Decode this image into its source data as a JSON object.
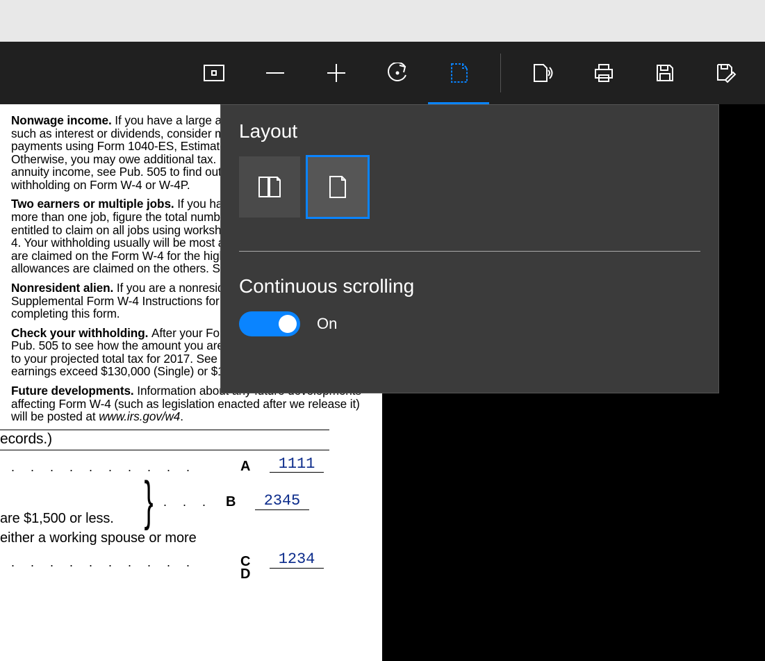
{
  "toolbar": {
    "icons": [
      "fit-page-icon",
      "zoom-out-icon",
      "zoom-in-icon",
      "rotate-icon",
      "layout-icon",
      "read-aloud-icon",
      "print-icon",
      "save-icon",
      "save-as-icon"
    ]
  },
  "flyout": {
    "layout_title": "Layout",
    "scroll_title": "Continuous scrolling",
    "toggle_state": "On"
  },
  "doc": {
    "p1_b": "Nonwage income. ",
    "p1": "If you have a large amount of nonwage income, such as interest or dividends, consider making estimated tax payments using Form 1040-ES, Estimated Tax for Individuals. Otherwise, you may owe additional tax. If you have pension or annuity income, see Pub. 505 to find out if you should adjust your withholding on Form W-4 or W-4P.",
    "p2_b": "Two earners or multiple jobs. ",
    "p2": "If you have a working spouse or more than one job, figure the total number of allowances you are entitled to claim on all jobs using worksheets from only one Form W-4. Your withholding usually will be most accurate when all allowances are claimed on the Form W-4 for the highest paying job and zero allowances are claimed on the others. See Pub. 505 for details.",
    "p3_b": "Nonresident alien. ",
    "p3": "If you are a nonresident alien, see Notice 1392, Supplemental Form W-4 Instructions for Nonresident Aliens, before completing this form.",
    "p4_b": "Check your withholding. ",
    "p4a": "After your Form W-4 takes effect, use Pub. 505 to see how the amount you are having withheld compares to your projected total tax for 2017. See Pub. 505, especially if your earnings exceed $130,000 (Single) or $180,000 (Married).",
    "p5_b": "Future developments. ",
    "p5a": "Information about any future developments affecting Form W-4 (such as legislation enacted after we release it) will be posted at ",
    "p5_url": "www.irs.gov/w4",
    "p5_end": ".",
    "records": "ecords.)",
    "rowA": {
      "dots": ". . . . . . . . . .",
      "letter": "A",
      "value": "1111"
    },
    "rowB": {
      "dots": ".   .   .",
      "letter": "B",
      "value": "2345",
      "text": " are $1,500 or less."
    },
    "lineC_text": "either a working spouse or more",
    "rowC": {
      "dots": ". . . . . . . . . .",
      "letter": "C",
      "value": "1234"
    },
    "rowD_letter": "D"
  }
}
